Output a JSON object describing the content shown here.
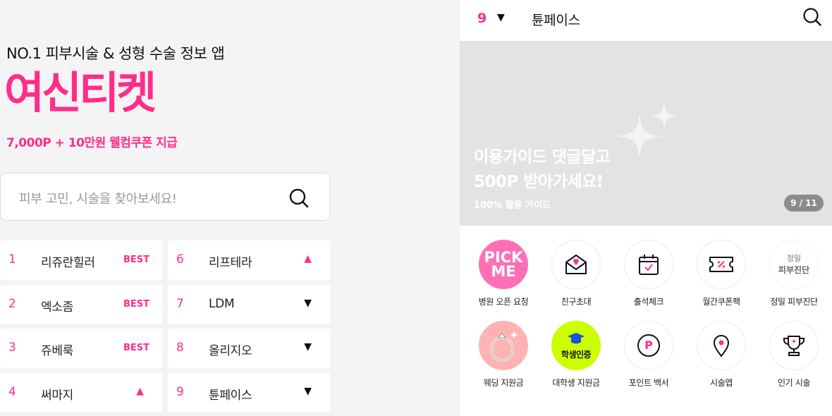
{
  "promo": {
    "tagline": "NO.1 피부시술 & 성형 수술 정보 앱",
    "logo": "여신티켓",
    "reward": "7,000P + 10만원 웰컴쿠폰 지급"
  },
  "search": {
    "placeholder": "피부 고민, 시술을 찾아보세요!",
    "icon": "search-icon"
  },
  "ranking": [
    {
      "rank": "1",
      "name": "리쥬란힐러",
      "badge": "BEST",
      "trend": ""
    },
    {
      "rank": "2",
      "name": "엑소좀",
      "badge": "BEST",
      "trend": ""
    },
    {
      "rank": "3",
      "name": "쥬베룩",
      "badge": "BEST",
      "trend": ""
    },
    {
      "rank": "4",
      "name": "써마지",
      "badge": "",
      "trend": "▲"
    },
    {
      "rank": "6",
      "name": "리프테라",
      "badge": "",
      "trend": "▲"
    },
    {
      "rank": "7",
      "name": "LDM",
      "badge": "",
      "trend": "▼"
    },
    {
      "rank": "8",
      "name": "올리지오",
      "badge": "",
      "trend": "▼"
    },
    {
      "rank": "9",
      "name": "튠페이스",
      "badge": "",
      "trend": "▼"
    }
  ],
  "topbar": {
    "rank": "9",
    "caret": "▼",
    "name": "튠페이스",
    "icon": "search-icon"
  },
  "banner": {
    "line1": "이용가이드 댓글달고",
    "line2": "500P 받아가세요!",
    "sub": "100% 활용 가이드",
    "pager": "9 / 11"
  },
  "menu": [
    {
      "label": "병원 오픈 요청",
      "icon": "pick-me-icon",
      "text": "PICK ME"
    },
    {
      "label": "친구초대",
      "icon": "heart-envelope-icon"
    },
    {
      "label": "출석체크",
      "icon": "calendar-check-icon"
    },
    {
      "label": "월간쿠폰팩",
      "icon": "coupon-icon"
    },
    {
      "label": "정밀 피부진단",
      "icon": "skin-diagnosis-icon",
      "text_top": "정밀",
      "text_bottom": "피부진단"
    },
    {
      "label": "웨딩 지원금",
      "icon": "ring-icon"
    },
    {
      "label": "대학생 지원금",
      "icon": "graduation-cap-icon",
      "text": "학생인증"
    },
    {
      "label": "포인트 백서",
      "icon": "point-icon",
      "text": "P"
    },
    {
      "label": "시술맵",
      "icon": "map-pin-icon"
    },
    {
      "label": "인기 시술",
      "icon": "trophy-icon"
    }
  ],
  "colors": {
    "accent": "#ff2d8a",
    "banner_bg": "#e3e3e3",
    "page_bg": "#f4f4f4"
  }
}
